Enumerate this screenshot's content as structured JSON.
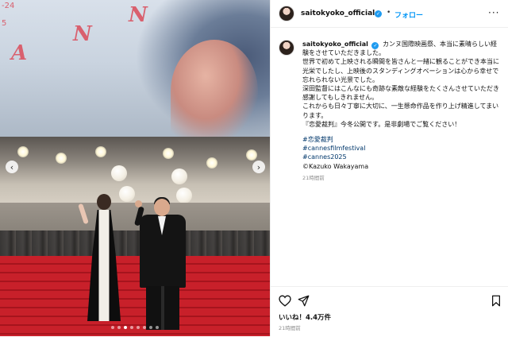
{
  "post": {
    "photo": {
      "poster_letters": [
        "N",
        "N",
        "A"
      ],
      "poster_date_lines": [
        "-24",
        "5"
      ],
      "nav_prev": "‹",
      "nav_next": "›",
      "dots": [
        false,
        false,
        true,
        false,
        false,
        false,
        false,
        false
      ],
      "alt": "cannes red carpet"
    },
    "header": {
      "username": "saitokyoko_official",
      "dot_sep": "•",
      "follow_label": "フォロー",
      "more_label": "···"
    },
    "caption": {
      "username": "saitokyoko_official",
      "lines": [
        "カンヌ国際映画祭、本当に素晴らしい経験をさせていただきました。",
        "世界で初めて上映される瞬間を皆さんと一緒に観ることができ本当に光栄でしたし、上映後のスタンディングオベーションは心から幸せで忘れられない光景でした。",
        "深田監督にはこんなにも奇跡な素敵な経験をたくさんさせていただき感謝してもしきれません。",
        "これからも日々丁寧に大切に、一生懸命作品を作り上げ精進してまいります。",
        "『恋愛裁判』今冬公開です。是非劇場でご覧ください！"
      ],
      "hashtags": [
        "#恋愛裁判",
        "#cannesfilmfestival",
        "#cannes2025"
      ],
      "credit": "©Kazuko Wakayama",
      "time": "21時間前"
    },
    "footer": {
      "likes": "いいね！4.4万件",
      "time": "21時間前"
    }
  },
  "colors": {
    "accent": "#0095f6",
    "hashtag": "#00376b",
    "verified": "#1f9bf0",
    "carpet": "#c8202a"
  },
  "icons": [
    "heart-icon",
    "share-icon",
    "bookmark-icon",
    "verified-icon",
    "chevron-left-icon",
    "chevron-right-icon"
  ]
}
